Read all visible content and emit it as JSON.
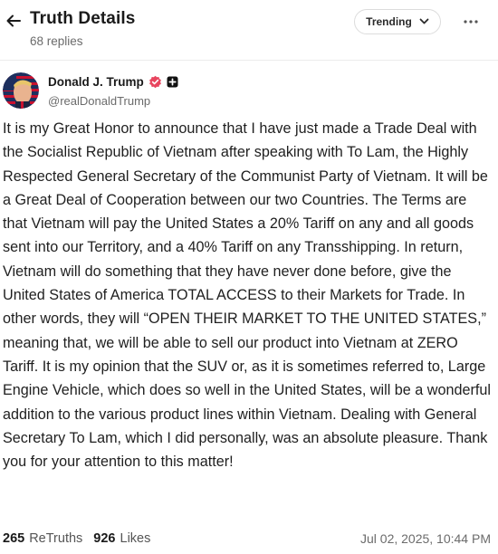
{
  "header": {
    "title": "Truth Details",
    "replies": "68 replies",
    "sort_label": "Trending"
  },
  "author": {
    "name": "Donald J. Trump",
    "handle": "@realDonaldTrump"
  },
  "post": {
    "text": "It is my Great Honor to announce that I have just made a Trade Deal with the Socialist Republic of Vietnam after speaking with To Lam, the Highly Respected General Secretary of the Communist Party of Vietnam. It will be a Great Deal of Cooperation between our two Countries. The Terms are that Vietnam will pay the United States a 20% Tariff on any and all goods sent into our Territory, and a 40% Tariff on any Transshipping. In return, Vietnam will do something that they have never done before, give the United States of America TOTAL ACCESS to their Markets for Trade. In other words, they will “OPEN THEIR MARKET TO THE UNITED STATES,” meaning that, we will be able to sell our product into Vietnam at ZERO Tariff. It is my opinion that the SUV or, as it is sometimes referred to, Large Engine Vehicle, which does so well in the United States, will be a wonderful addition to the various product lines within Vietnam. Dealing with General Secretary To Lam, which I did personally, was an absolute pleasure. Thank you for your attention to this matter!"
  },
  "stats": {
    "retruths_count": "265",
    "retruths_label": "ReTruths",
    "likes_count": "926",
    "likes_label": "Likes",
    "timestamp": "Jul 02, 2025, 10:44 PM"
  },
  "colors": {
    "verified": "#e8455f",
    "text": "#1f1f1f",
    "muted": "#6b6b6b"
  },
  "icons": {
    "back": "arrow-left-icon",
    "sort": "chevron-down-icon",
    "more": "more-horizontal-icon",
    "verified": "verified-badge-icon",
    "plus": "plus-square-icon"
  }
}
